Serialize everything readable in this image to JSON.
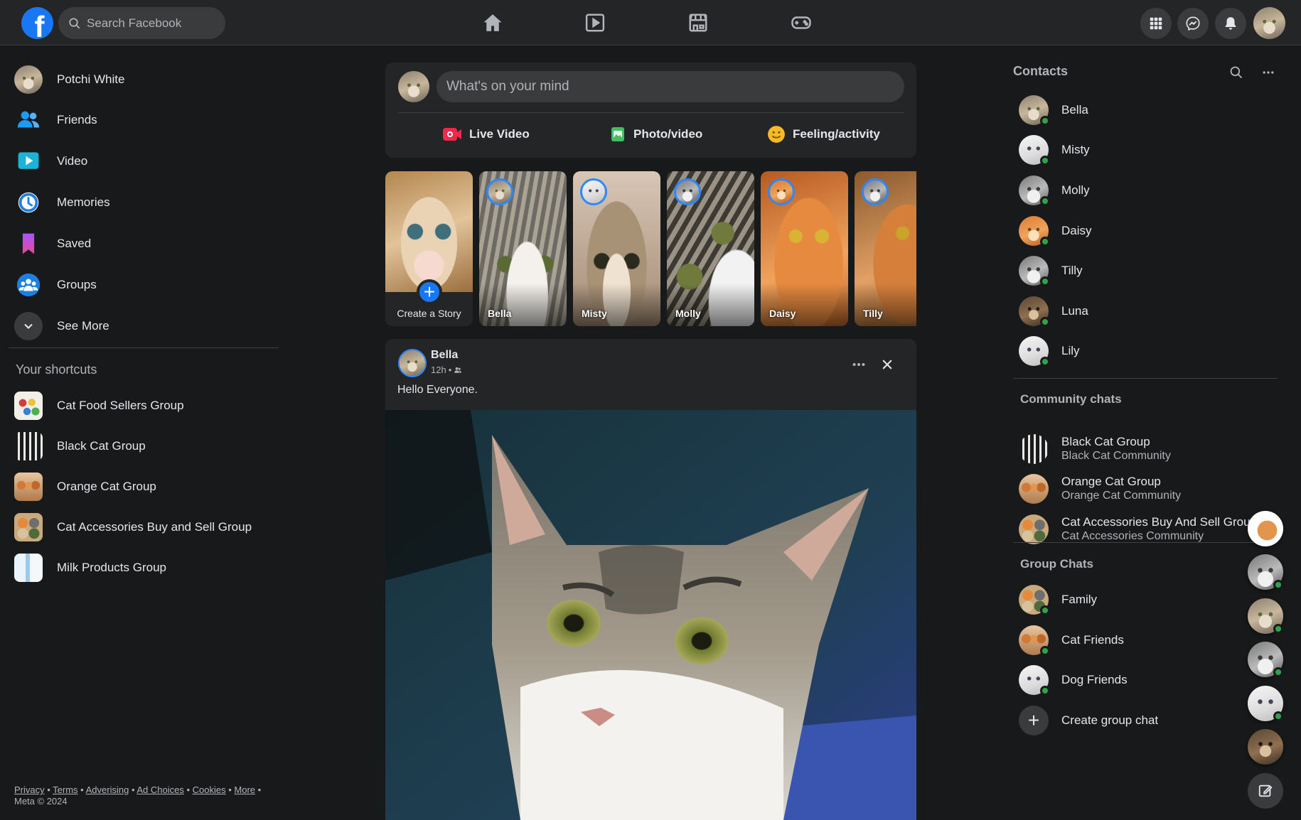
{
  "header": {
    "logo_letter": "f",
    "search_placeholder": "Search Facebook",
    "nav": [
      {
        "name": "home",
        "icon": "home-icon"
      },
      {
        "name": "watch",
        "icon": "video-play-icon"
      },
      {
        "name": "marketplace",
        "icon": "marketplace-icon"
      },
      {
        "name": "gaming",
        "icon": "gamepad-icon"
      }
    ],
    "right_buttons": [
      "apps-grid-icon",
      "messenger-icon",
      "bell-icon"
    ]
  },
  "sidebar": {
    "profile_name": "Potchi White",
    "items": [
      {
        "label": "Friends",
        "icon": "friends-icon"
      },
      {
        "label": "Video",
        "icon": "video-icon"
      },
      {
        "label": "Memories",
        "icon": "memories-clock-icon"
      },
      {
        "label": "Saved",
        "icon": "bookmark-icon"
      },
      {
        "label": "Groups",
        "icon": "groups-icon"
      },
      {
        "label": "See More",
        "icon": "chevron-down-icon"
      }
    ],
    "shortcuts_title": "Your shortcuts",
    "shortcuts": [
      {
        "label": "Cat Food Sellers Group"
      },
      {
        "label": "Black Cat Group"
      },
      {
        "label": "Orange Cat Group"
      },
      {
        "label": "Cat Accessories Buy and Sell Group"
      },
      {
        "label": "Milk Products Group"
      }
    ],
    "footer_links": [
      "Privacy",
      "Terms",
      "Adverising",
      "Ad Choices",
      "Cookies",
      "More"
    ],
    "footer_copyright": "Meta © 2024"
  },
  "composer": {
    "placeholder": "What's on your mind",
    "actions": [
      "Live Video",
      "Photo/video",
      "Feeling/activity"
    ]
  },
  "stories": {
    "create_label": "Create a Story",
    "items": [
      "Bella",
      "Misty",
      "Molly",
      "Daisy",
      "Tilly"
    ]
  },
  "post": {
    "author": "Bella",
    "time": "12h",
    "meta_separator": "•",
    "text": "Hello Everyone."
  },
  "contacts": {
    "title": "Contacts",
    "people": [
      "Bella",
      "Misty",
      "Molly",
      "Daisy",
      "Tilly",
      "Luna",
      "Lily"
    ],
    "community_title": "Community chats",
    "communities": [
      {
        "name": "Black Cat Group",
        "sub": "Black Cat Community"
      },
      {
        "name": "Orange Cat Group",
        "sub": "Orange Cat Community"
      },
      {
        "name": "Cat Accessories Buy And Sell Group",
        "sub": "Cat Accessories Community"
      }
    ],
    "group_title": "Group Chats",
    "groups": [
      "Family",
      "Cat Friends",
      "Dog Friends"
    ],
    "create_group": "Create group chat"
  },
  "colors": {
    "background": "#18191a",
    "surface": "#242526",
    "accent": "#1877f2",
    "online": "#31a24c"
  }
}
